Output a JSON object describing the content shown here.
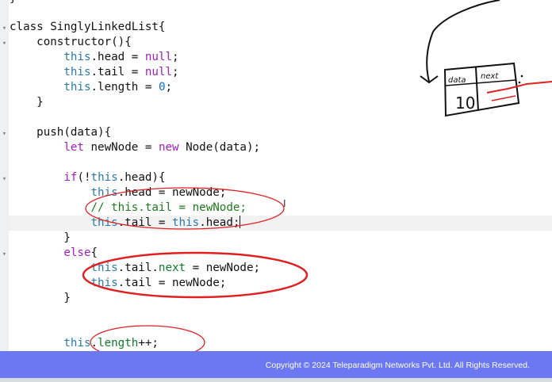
{
  "code_lines": [
    [
      {
        "t": "}"
      }
    ],
    [
      {
        "t": "class "
      },
      {
        "t": "SinglyLinkedList"
      },
      {
        "t": "{"
      }
    ],
    [
      {
        "t": "    constructor(){"
      }
    ],
    [
      {
        "t": "        "
      },
      {
        "t": "this",
        "c": "th"
      },
      {
        "t": ".head = "
      },
      {
        "t": "null",
        "c": "kw"
      },
      {
        "t": ";"
      }
    ],
    [
      {
        "t": "        "
      },
      {
        "t": "this",
        "c": "th"
      },
      {
        "t": ".tail = "
      },
      {
        "t": "null",
        "c": "kw"
      },
      {
        "t": ";"
      }
    ],
    [
      {
        "t": "        "
      },
      {
        "t": "this",
        "c": "th"
      },
      {
        "t": ".length = "
      },
      {
        "t": "0",
        "c": "nu"
      },
      {
        "t": ";"
      }
    ],
    [
      {
        "t": "    }"
      }
    ],
    [
      {
        "t": ""
      }
    ],
    [
      {
        "t": "    push(data){"
      }
    ],
    [
      {
        "t": "        "
      },
      {
        "t": "let",
        "c": "kw"
      },
      {
        "t": " newNode = "
      },
      {
        "t": "new",
        "c": "kw"
      },
      {
        "t": " Node(data);"
      }
    ],
    [
      {
        "t": ""
      }
    ],
    [
      {
        "t": "        "
      },
      {
        "t": "if",
        "c": "kw"
      },
      {
        "t": "(!"
      },
      {
        "t": "this",
        "c": "th"
      },
      {
        "t": ".head){"
      }
    ],
    [
      {
        "t": "            "
      },
      {
        "t": "this",
        "c": "th"
      },
      {
        "t": ".head = newNode;"
      }
    ],
    [
      {
        "t": "            "
      },
      {
        "t": "// this.tail = newNode;",
        "c": "cm"
      }
    ],
    [
      {
        "t": "            "
      },
      {
        "t": "this",
        "c": "th"
      },
      {
        "t": ".tail = "
      },
      {
        "t": "this",
        "c": "th"
      },
      {
        "t": ".head;"
      }
    ],
    [
      {
        "t": "        }"
      }
    ],
    [
      {
        "t": "        "
      },
      {
        "t": "else",
        "c": "kw"
      },
      {
        "t": "{"
      }
    ],
    [
      {
        "t": "            "
      },
      {
        "t": "this",
        "c": "th"
      },
      {
        "t": ".tail."
      },
      {
        "t": "next",
        "c": "pr"
      },
      {
        "t": " = newNode;"
      }
    ],
    [
      {
        "t": "            "
      },
      {
        "t": "this",
        "c": "th"
      },
      {
        "t": ".tail = newNode;"
      }
    ],
    [
      {
        "t": "        }"
      }
    ],
    [
      {
        "t": ""
      }
    ],
    [
      {
        "t": ""
      }
    ],
    [
      {
        "t": "        "
      },
      {
        "t": "this",
        "c": "th"
      },
      {
        "t": "."
      },
      {
        "t": "length",
        "c": "pr"
      },
      {
        "t": "++;"
      }
    ]
  ],
  "fold_markers": [
    "▾",
    "▾",
    "▾",
    "▾",
    "▾"
  ],
  "cursor_line": 14,
  "annotation": {
    "box_labels": [
      "data",
      "next"
    ],
    "node_value": "10"
  },
  "footer": {
    "copyright": "Copyright © 2024 Teleparadigm Networks Pvt. Ltd. All Rights Reserved."
  },
  "colors": {
    "keyword": "#a11fbd",
    "this": "#2a79ac",
    "property": "#0f7a2c",
    "number": "#0b6cd0",
    "comment": "#1e7a1e",
    "annotation_red": "#e02020",
    "footer_bg": "#6b78f2"
  }
}
